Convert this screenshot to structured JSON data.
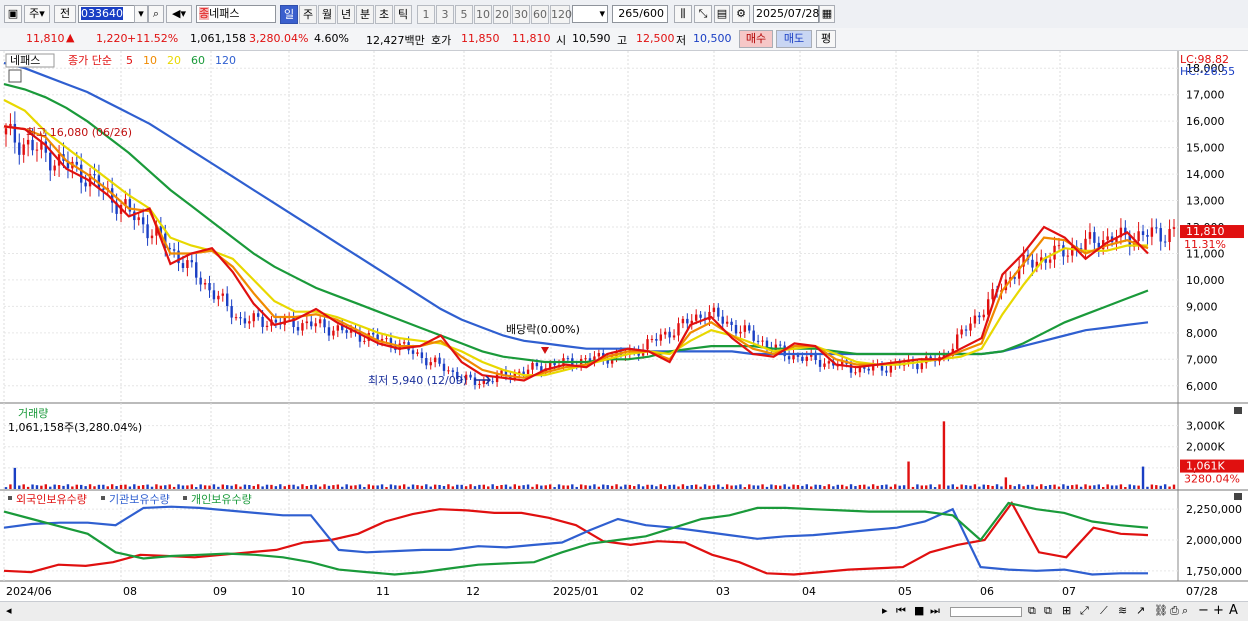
{
  "toolbar": {
    "market_label": "주",
    "prev_label": "전",
    "code_value": "033640",
    "stock_name": "네패스",
    "stock_prefix": "종",
    "periods": [
      {
        "label": "일",
        "selected": true
      },
      {
        "label": "주"
      },
      {
        "label": "월"
      },
      {
        "label": "년"
      },
      {
        "label": "분"
      },
      {
        "label": "초"
      },
      {
        "label": "틱"
      }
    ],
    "interval_options": [
      "1",
      "3",
      "5",
      "10",
      "20",
      "30",
      "60",
      "120"
    ],
    "count_value": "265",
    "count_total": "/600",
    "date_value": "2025/07/28"
  },
  "quote": {
    "price": "11,810",
    "change_arrow": "▲",
    "change": "1,220",
    "change_pct": "+11.52%",
    "volume": "1,061,158",
    "volume_pct": "3,280.04%",
    "turnover_pct": "4.60%",
    "amount": "12,427백만",
    "hoga_label": "호가",
    "hoga_ask": "11,850",
    "hoga_bid": "11,810",
    "open_label": "시",
    "open": "10,590",
    "high_label": "고",
    "high": "12,500",
    "low_label": "저",
    "low": "10,500",
    "buy_label": "매수",
    "sell_label": "매도",
    "avg_label": "평"
  },
  "price_panel": {
    "name_tag": "네패스",
    "legend_prefix": "종가 단순",
    "ma_labels": [
      {
        "label": "5",
        "color": "#e01010"
      },
      {
        "label": "10",
        "color": "#f08a00"
      },
      {
        "label": "20",
        "color": "#e8d800"
      },
      {
        "label": "60",
        "color": "#1a9a3a"
      },
      {
        "label": "120",
        "color": "#2f5fd0"
      }
    ],
    "lc_label": "LC:98.82",
    "hc_label": "HC:-26.55",
    "high_annotation": "최고 16,080 (06/26)",
    "low_annotation": "최저 5,940 (12/09)",
    "dividend_annotation": "배당락(0.00%)",
    "y_ticks": [
      "18,000",
      "17,000",
      "16,000",
      "15,000",
      "14,000",
      "13,000",
      "12,000",
      "11,000",
      "10,000",
      "9,000",
      "8,000",
      "7,000",
      "6,000"
    ],
    "last_price_tag": "11,810",
    "last_pct_tag": "11.31%"
  },
  "volume_panel": {
    "title": "거래량",
    "value_text": "1,061,158주(3,280.04%)",
    "y_ticks": [
      "3,000K",
      "2,000K",
      "1,000K"
    ],
    "last_tag": "1,061K",
    "last_pct_tag": "3280.04%"
  },
  "holdings_panel": {
    "legend": [
      {
        "label": "외국인보유수량",
        "color": "#e01010"
      },
      {
        "label": "기관보유수량",
        "color": "#2f5fd0"
      },
      {
        "label": "개인보유수량",
        "color": "#1a9a3a"
      }
    ],
    "y_ticks": [
      "2,250,000",
      "2,000,000",
      "1,750,000"
    ]
  },
  "x_axis": {
    "labels": [
      "2024/06",
      "08",
      "09",
      "10",
      "11",
      "12",
      "2025/01",
      "02",
      "03",
      "04",
      "05",
      "06",
      "07"
    ],
    "right_label": "07/28"
  },
  "chart_data": [
    {
      "type": "candlestick",
      "title": "네패스 종가 단순 5 10 20 60 120",
      "ylim": [
        5500,
        18500
      ],
      "x_range": [
        "2024/06",
        "2025/07/28"
      ],
      "key_points": [
        {
          "x": "2024/06",
          "close": 15500
        },
        {
          "x": "2024/07",
          "close": 14000
        },
        {
          "x": "2024/08",
          "close": 11500
        },
        {
          "x": "2024/09",
          "close": 8500
        },
        {
          "x": "2024/10",
          "close": 8300
        },
        {
          "x": "2024/11",
          "close": 7600
        },
        {
          "x": "2024/12",
          "close": 6100
        },
        {
          "x": "2025/01",
          "close": 6800
        },
        {
          "x": "2025/02",
          "close": 7200
        },
        {
          "x": "2025/02b",
          "close": 8800
        },
        {
          "x": "2025/03",
          "close": 7200
        },
        {
          "x": "2025/04",
          "close": 6600
        },
        {
          "x": "2025/05",
          "close": 7000
        },
        {
          "x": "2025/06",
          "close": 10500
        },
        {
          "x": "2025/07",
          "close": 11500
        },
        {
          "x": "2025/07/28",
          "close": 11810
        }
      ],
      "series": [
        {
          "name": "5",
          "points": [
            15800,
            15700,
            15100,
            14200,
            13800,
            13200,
            12400,
            12700,
            10600,
            11000,
            11200,
            10300,
            9100,
            8300,
            8500,
            8900,
            8400,
            8000,
            7600,
            7400,
            7500,
            7900,
            6900,
            6400,
            6300,
            6200,
            6600,
            6800,
            6700,
            7200,
            7400,
            7300,
            6900,
            8300,
            8600,
            7800,
            7200,
            7100,
            7600,
            7500,
            6800,
            6700,
            6800,
            6900,
            7000,
            7000,
            7400,
            7800,
            10200,
            11000,
            12000,
            11600,
            10800,
            11400,
            11800,
            11000
          ]
        },
        {
          "name": "10",
          "points": [
            15800,
            15700,
            15400,
            14500,
            14000,
            13400,
            12700,
            12600,
            11000,
            11000,
            11100,
            10500,
            9500,
            8600,
            8600,
            8700,
            8500,
            8100,
            7700,
            7500,
            7500,
            7700,
            7100,
            6600,
            6400,
            6300,
            6500,
            6700,
            6800,
            7100,
            7300,
            7300,
            7000,
            8000,
            8400,
            7900,
            7400,
            7200,
            7500,
            7500,
            7000,
            6800,
            6800,
            6900,
            7000,
            7000,
            7300,
            7600,
            9600,
            10600,
            11600,
            11500,
            11000,
            11300,
            11500,
            11200
          ]
        },
        {
          "name": "20",
          "points": [
            16800,
            16400,
            15600,
            15000,
            14400,
            13800,
            13200,
            12700,
            11600,
            11300,
            11100,
            10800,
            10000,
            9200,
            8800,
            8800,
            8600,
            8300,
            8000,
            7800,
            7700,
            7600,
            7300,
            6900,
            6600,
            6400,
            6400,
            6600,
            6800,
            7000,
            7200,
            7300,
            7200,
            7700,
            8100,
            7900,
            7600,
            7300,
            7400,
            7500,
            7200,
            6900,
            6800,
            6800,
            6900,
            7000,
            7100,
            7400,
            8700,
            9800,
            10800,
            11200,
            11100,
            11100,
            11300,
            11300
          ]
        },
        {
          "name": "60",
          "points": [
            17400,
            17200,
            16900,
            16500,
            16000,
            15400,
            14800,
            14100,
            13400,
            12800,
            12200,
            11600,
            11000,
            10500,
            10100,
            9700,
            9400,
            9100,
            8800,
            8500,
            8200,
            7900,
            7600,
            7300,
            7100,
            7000,
            6900,
            6900,
            6900,
            7000,
            7000,
            7100,
            7300,
            7400,
            7500,
            7500,
            7500,
            7400,
            7400,
            7400,
            7300,
            7200,
            7200,
            7200,
            7200,
            7200,
            7200,
            7200,
            7300,
            7600,
            8000,
            8400,
            8700,
            9000,
            9300,
            9600
          ]
        },
        {
          "name": "120",
          "points": [
            18200,
            18000,
            17700,
            17400,
            17100,
            16700,
            16300,
            15900,
            15400,
            14900,
            14400,
            13900,
            13400,
            12900,
            12400,
            11900,
            11400,
            10900,
            10400,
            9900,
            9400,
            8900,
            8500,
            8200,
            7900,
            7700,
            7600,
            7500,
            7400,
            7400,
            7400,
            7300,
            7300,
            7300,
            7300,
            7300,
            7200,
            7200,
            7200,
            7200,
            7200,
            7200,
            7200,
            7200,
            7200,
            7200,
            7200,
            7200,
            7300,
            7500,
            7700,
            7900,
            8100,
            8200,
            8300,
            8400
          ]
        }
      ]
    },
    {
      "type": "bar",
      "title": "거래량",
      "ylim": [
        0,
        3500
      ],
      "unit": "K",
      "spikes": [
        {
          "x": "2024/06",
          "value": 1000
        },
        {
          "x": "2025/06",
          "value": 1300
        },
        {
          "x": "2025/06b",
          "value": 3200
        },
        {
          "x": "2025/07",
          "value": 550
        },
        {
          "x": "2025/07/28",
          "value": 1061
        }
      ],
      "baseline": 150
    },
    {
      "type": "line",
      "title": "외국인보유수량 기관보유수량 개인보유수량",
      "ylim": [
        1700000,
        2300000
      ],
      "series": [
        {
          "name": "외국인보유수량",
          "points": [
            1750000,
            1740000,
            1800000,
            1790000,
            1820000,
            1880000,
            1870000,
            1860000,
            1880000,
            1900000,
            1920000,
            1980000,
            2000000,
            2050000,
            2150000,
            2210000,
            2250000,
            2240000,
            2220000,
            2220000,
            2180000,
            2120000,
            1990000,
            1960000,
            1990000,
            1980000,
            1880000,
            1820000,
            1730000,
            1720000,
            1740000,
            1760000,
            1770000,
            1780000,
            1900000,
            1960000,
            2000000,
            2300000,
            1900000,
            1860000,
            2100000,
            2050000,
            2040000
          ]
        },
        {
          "name": "기관보유수량",
          "points": [
            2100000,
            2130000,
            2140000,
            2140000,
            2120000,
            2260000,
            2270000,
            2260000,
            2240000,
            2220000,
            2200000,
            2200000,
            1920000,
            1900000,
            1910000,
            1920000,
            1920000,
            1950000,
            1940000,
            1960000,
            1980000,
            2080000,
            2170000,
            2120000,
            2100000,
            2070000,
            2040000,
            2010000,
            2030000,
            2040000,
            2060000,
            2080000,
            2100000,
            2150000,
            2250000,
            1780000,
            1760000,
            1750000,
            1760000,
            1720000,
            1730000,
            1730000
          ]
        },
        {
          "name": "개인보유수량",
          "points": [
            2230000,
            2170000,
            2110000,
            2050000,
            1900000,
            1850000,
            1870000,
            1880000,
            1890000,
            1880000,
            1860000,
            1820000,
            1760000,
            1740000,
            1720000,
            1740000,
            1770000,
            1800000,
            1810000,
            1820000,
            1900000,
            1970000,
            2000000,
            2030000,
            2100000,
            2170000,
            2200000,
            2260000,
            2260000,
            2250000,
            2240000,
            2230000,
            2230000,
            2230000,
            2200000,
            2000000,
            2300000,
            2250000,
            2220000,
            2150000,
            2120000,
            2100000
          ]
        }
      ]
    }
  ]
}
